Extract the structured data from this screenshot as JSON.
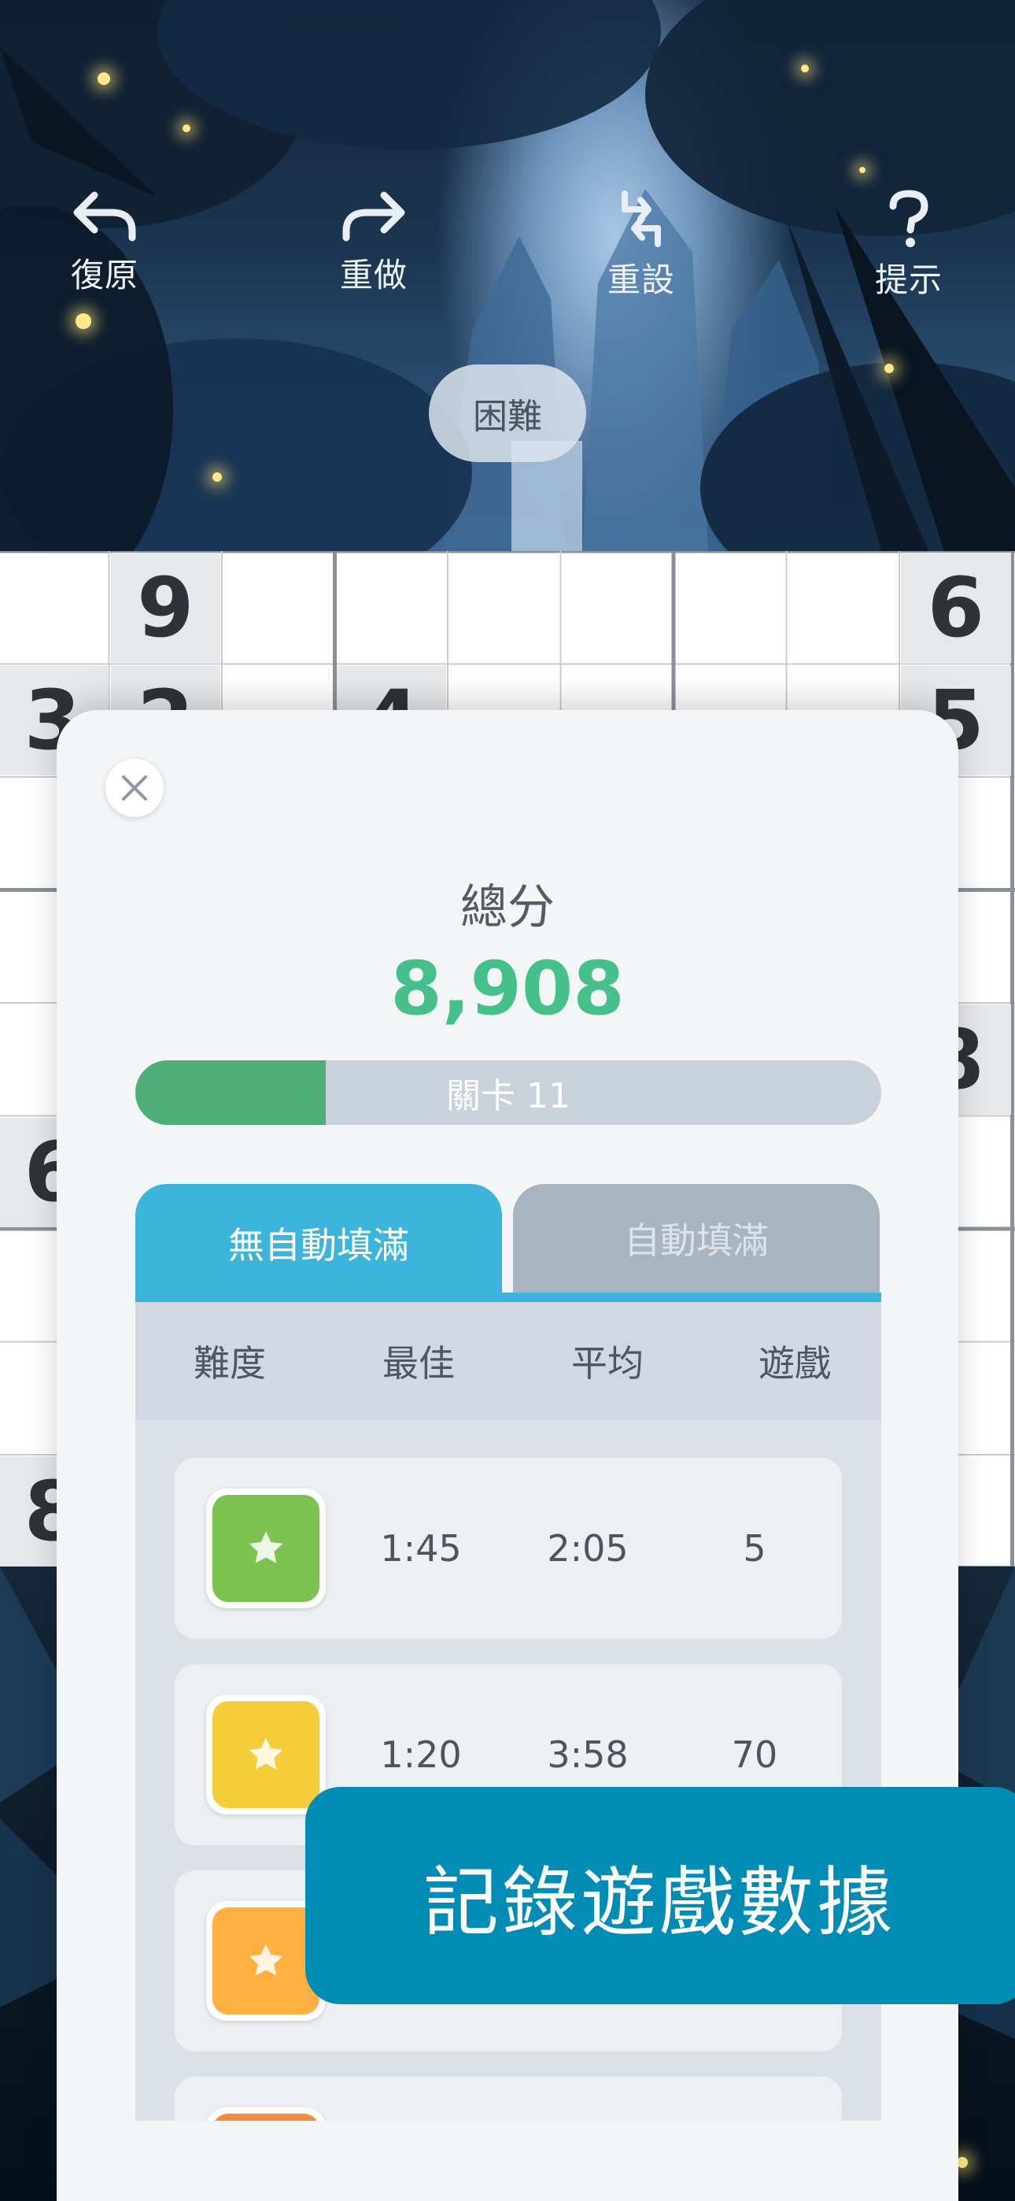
{
  "toolbar": {
    "undo_label": "復原",
    "redo_label": "重做",
    "reset_label": "重設",
    "hint_label": "提示"
  },
  "difficulty_badge": "困難",
  "board": {
    "visible_digits": [
      {
        "row": 0,
        "col": 1,
        "value": "9"
      },
      {
        "row": 0,
        "col": 8,
        "value": "6"
      },
      {
        "row": 1,
        "col": 0,
        "value": "3"
      },
      {
        "row": 1,
        "col": 1,
        "value": "2"
      },
      {
        "row": 1,
        "col": 3,
        "value": "4"
      },
      {
        "row": 1,
        "col": 8,
        "value": "5"
      },
      {
        "row": 4,
        "col": 8,
        "value": "8"
      },
      {
        "row": 5,
        "col": 0,
        "value": "6"
      },
      {
        "row": 8,
        "col": 0,
        "value": "8"
      }
    ]
  },
  "stats": {
    "total_label": "總分",
    "total_value": "8,908",
    "level_label": "關卡 11",
    "level_progress_fraction": 0.255,
    "tabs": {
      "active": "無自動填滿",
      "inactive": "自動填滿"
    },
    "columns": {
      "difficulty": "難度",
      "best": "最佳",
      "average": "平均",
      "games": "遊戲"
    },
    "rows": [
      {
        "difficulty_color": "#7cc251",
        "best": "1:45",
        "average": "2:05",
        "games": "5"
      },
      {
        "difficulty_color": "#f5cc3a",
        "best": "1:20",
        "average": "3:58",
        "games": "70"
      },
      {
        "difficulty_color": "#ffb040",
        "best": "",
        "average": "",
        "games": ""
      },
      {
        "difficulty_color": "#f48c3c",
        "best": "",
        "average": "",
        "games": ""
      }
    ]
  },
  "banner_text": "記錄遊戲數據",
  "colors": {
    "accent_blue": "#3cb4dc",
    "score_green": "#46c08a",
    "banner_blue": "#008cb4"
  }
}
